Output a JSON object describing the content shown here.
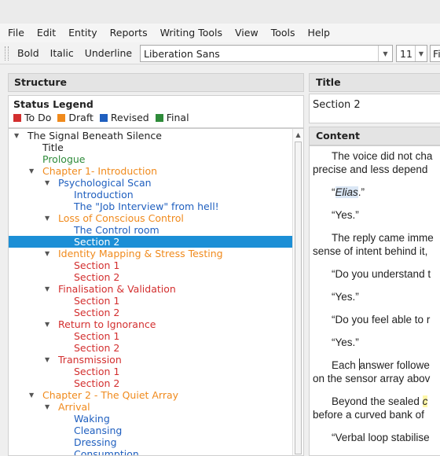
{
  "menu": [
    "File",
    "Edit",
    "Entity",
    "Reports",
    "Writing Tools",
    "View",
    "Tools",
    "Help"
  ],
  "toolbar": {
    "bold": "Bold",
    "italic": "Italic",
    "underline": "Underline",
    "font": "Liberation Sans",
    "size": "11",
    "extra": "Fi"
  },
  "structure": {
    "header": "Structure",
    "legend_title": "Status Legend",
    "legend": [
      {
        "label": "To Do",
        "color": "#d32f2f"
      },
      {
        "label": "Draft",
        "color": "#f08a1c"
      },
      {
        "label": "Revised",
        "color": "#1f5fbf"
      },
      {
        "label": "Final",
        "color": "#2e8b3a"
      }
    ],
    "tree": [
      {
        "label": "The Signal Beneath Silence",
        "level": 0,
        "expanded": true,
        "status": "none"
      },
      {
        "label": "Title",
        "level": 1,
        "status": "none"
      },
      {
        "label": "Prologue",
        "level": 1,
        "status": "final"
      },
      {
        "label": "Chapter 1- Introduction",
        "level": 1,
        "expanded": true,
        "status": "draft"
      },
      {
        "label": "Psychological Scan",
        "level": 2,
        "expanded": true,
        "status": "revised"
      },
      {
        "label": "Introduction",
        "level": 3,
        "status": "revised"
      },
      {
        "label": "The \"Job Interview\" from hell!",
        "level": 3,
        "status": "revised"
      },
      {
        "label": "Loss of Conscious Control",
        "level": 2,
        "expanded": true,
        "status": "draft"
      },
      {
        "label": "The Control room",
        "level": 3,
        "status": "revised"
      },
      {
        "label": "Section 2",
        "level": 3,
        "status": "todo",
        "selected": true
      },
      {
        "label": "Identity Mapping & Stress Testing",
        "level": 2,
        "expanded": true,
        "status": "draft"
      },
      {
        "label": "Section 1",
        "level": 3,
        "status": "todo"
      },
      {
        "label": "Section 2",
        "level": 3,
        "status": "todo"
      },
      {
        "label": "Finalisation & Validation",
        "level": 2,
        "expanded": true,
        "status": "todo"
      },
      {
        "label": "Section 1",
        "level": 3,
        "status": "todo"
      },
      {
        "label": "Section 2",
        "level": 3,
        "status": "todo"
      },
      {
        "label": "Return to Ignorance",
        "level": 2,
        "expanded": true,
        "status": "todo"
      },
      {
        "label": "Section 1",
        "level": 3,
        "status": "todo"
      },
      {
        "label": "Section 2",
        "level": 3,
        "status": "todo"
      },
      {
        "label": "Transmission",
        "level": 2,
        "expanded": true,
        "status": "todo"
      },
      {
        "label": "Section 1",
        "level": 3,
        "status": "todo"
      },
      {
        "label": "Section 2",
        "level": 3,
        "status": "todo"
      },
      {
        "label": "Chapter 2 - The Quiet Array",
        "level": 1,
        "expanded": true,
        "status": "draft"
      },
      {
        "label": "Arrival",
        "level": 2,
        "expanded": true,
        "status": "draft"
      },
      {
        "label": "Waking",
        "level": 3,
        "status": "revised"
      },
      {
        "label": "Cleansing",
        "level": 3,
        "status": "revised"
      },
      {
        "label": "Dressing",
        "level": 3,
        "status": "revised"
      },
      {
        "label": "Consumption",
        "level": 3,
        "status": "revised"
      }
    ]
  },
  "editor": {
    "title_header": "Title",
    "title_value": "Section 2",
    "content_header": "Content",
    "p1a": "The voice did not cha",
    "p1b": "precise and less depend",
    "p2_open": "“",
    "p2_name": "Elias",
    "p2_close": ".”",
    "p3": "“Yes.”",
    "p4a": "The reply came imme",
    "p4b": "sense of intent behind it,",
    "p5": "“Do you understand t",
    "p6": "“Yes.”",
    "p7": "“Do you feel able to r",
    "p8": "“Yes.”",
    "p9a_pre": "Each ",
    "p9a_post": "answer followe",
    "p9b": "on the sensor array abov",
    "p10a_pre": "Beyond the sealed ",
    "p10a_hl": "c",
    "p10b": "before a curved bank of",
    "p11": "“Verbal loop stabilise"
  },
  "colors": {
    "todo": "#d32f2f",
    "draft": "#f08a1c",
    "revised": "#1f5fbf",
    "final": "#2e8b3a",
    "none": "#222222",
    "selection": "#1c8fd6"
  }
}
